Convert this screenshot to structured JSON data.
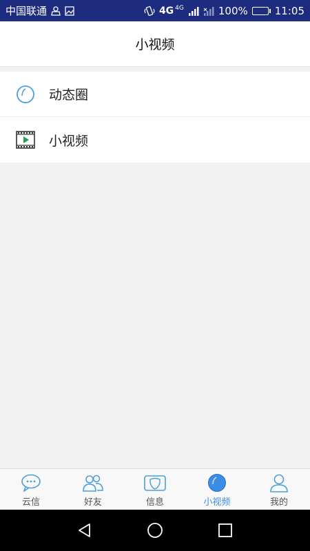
{
  "status_bar": {
    "carrier": "中国联通",
    "network": "4G",
    "network_small": "4G",
    "battery_percent": "100%",
    "battery_level": 1.0,
    "time": "11:05",
    "icons": [
      "person-icon",
      "image-icon",
      "vibrate-icon",
      "signal-icon",
      "signal-weak-icon",
      "battery-charging-icon"
    ]
  },
  "header": {
    "title": "小视频"
  },
  "menu": {
    "items": [
      {
        "label": "动态圈",
        "icon": "moments-circle-icon"
      },
      {
        "label": "小视频",
        "icon": "video-film-icon"
      }
    ]
  },
  "tabs": [
    {
      "label": "云信",
      "icon": "chat-bubble-icon",
      "active": false
    },
    {
      "label": "好友",
      "icon": "friends-icon",
      "active": false
    },
    {
      "label": "信息",
      "icon": "info-shield-icon",
      "active": false
    },
    {
      "label": "小视频",
      "icon": "video-circle-icon",
      "active": true
    },
    {
      "label": "我的",
      "icon": "profile-icon",
      "active": false
    }
  ],
  "nav_bar": {
    "icons": [
      "back-icon",
      "home-icon",
      "recents-icon"
    ]
  },
  "colors": {
    "status_bar": "#1d2c7e",
    "accent": "#3a8ee6",
    "icon_blue": "#4a9fd8",
    "video_green": "#22a04b"
  }
}
